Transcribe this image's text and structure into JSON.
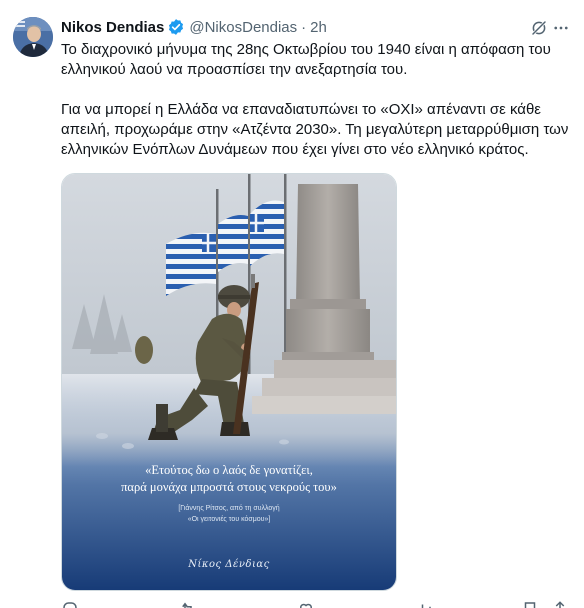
{
  "author": {
    "display_name": "Nikos Dendias",
    "handle": "@NikosDendias",
    "separator": "·",
    "time": "2h",
    "verified": true,
    "avatar_icon": "profile-photo"
  },
  "tweet": {
    "paragraph_1": "Το διαχρονικό μήνυμα της 28ης Οκτωβρίου του 1940 είναι η απόφαση του ελληνικού λαού να προασπίσει την ανεξαρτησία του.",
    "paragraph_2": "Για να μπορεί η Ελλάδα να επαναδιατυπώνει το «ΟΧΙ» απέναντι σε κάθε απειλή, προχωράμε στην «Ατζέντα 2030». Τη μεγαλύτερη μεταρρύθμιση των ελληνικών Ενόπλων Δυνάμεων που έχει γίνει στο νέο ελληνικό κράτος."
  },
  "media": {
    "quote_line_1": "«Ετούτος δω ο λαός δε γονατίζει,",
    "quote_line_2": "παρά μονάχα μπροστά στους νεκρούς του»",
    "source_line_1": "[Γιάννης Ρίτσος, από τη συλλογή",
    "source_line_2": "«Οι γειτονιές του κόσμου»]",
    "signature": "Νίκος Δένδιας"
  },
  "icons": {
    "verified": "verified-badge-icon",
    "grok": "grok-icon",
    "more": "more-icon",
    "actions": [
      "reply-icon",
      "repost-icon",
      "like-icon",
      "views-icon",
      "bookmark-icon",
      "share-icon"
    ]
  },
  "colors": {
    "text_primary": "#0f1419",
    "text_secondary": "#536471",
    "verified_blue": "#1d9bf0",
    "image_blue": "#1b3f7a"
  }
}
